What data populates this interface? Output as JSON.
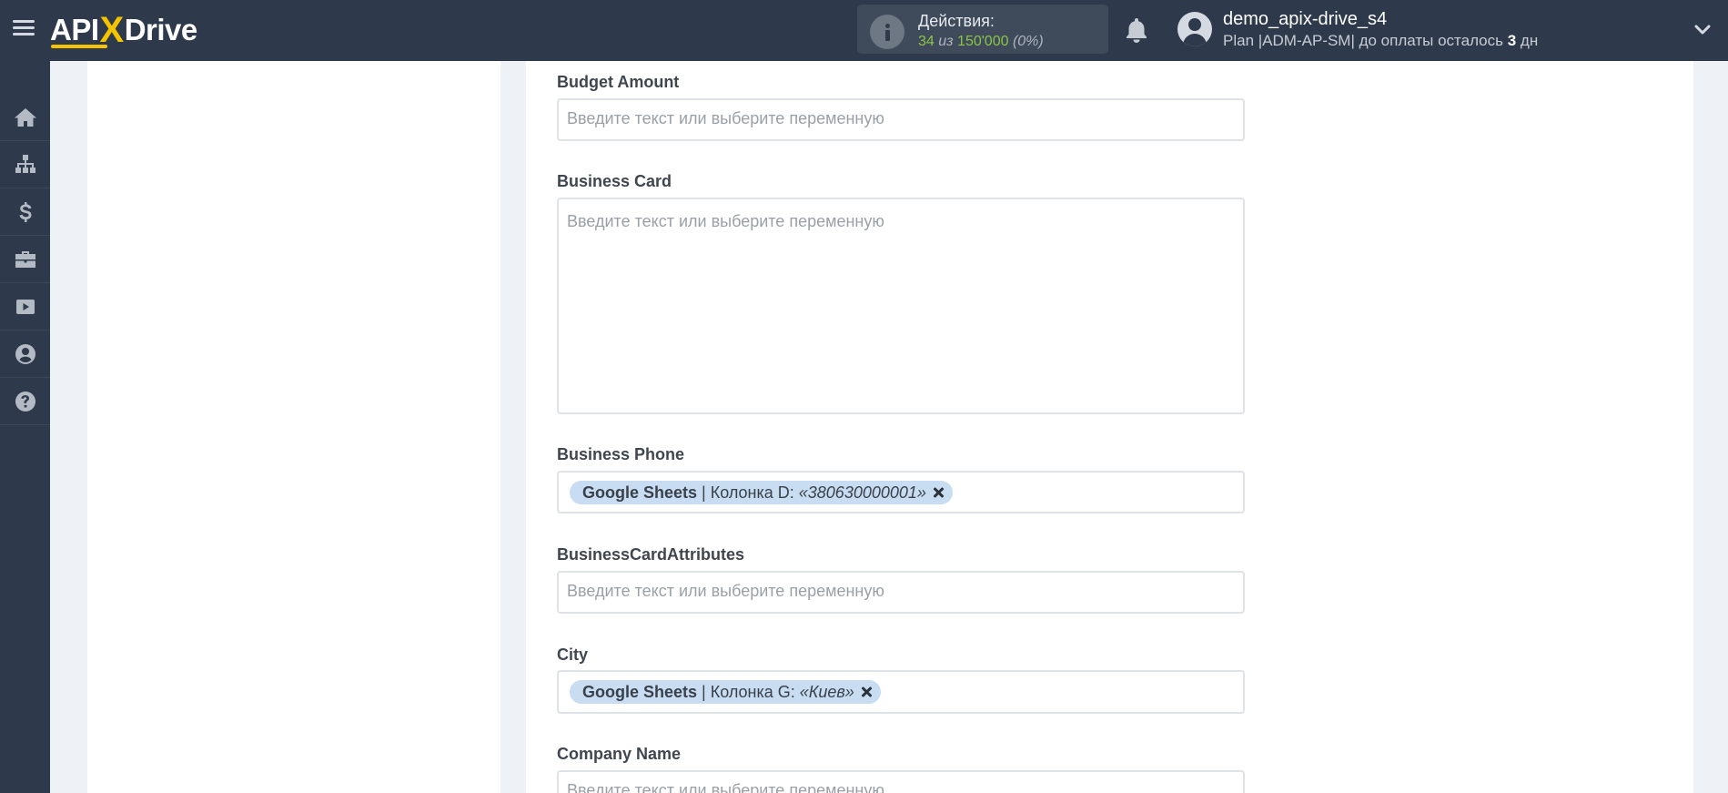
{
  "brand": {
    "logo_text_left": "API",
    "logo_text_x": "X",
    "logo_text_right": "Drive"
  },
  "header": {
    "actions_title": "Действия:",
    "actions_used": "34",
    "actions_of": "из",
    "actions_total": "150'000",
    "actions_pct": "(0%)",
    "user_name": "demo_apix-drive_s4",
    "plan_prefix": "Plan |ADM-AP-SM| до оплаты осталось ",
    "plan_days": "3",
    "plan_suffix": " дн"
  },
  "sidebar": {
    "items": [
      {
        "icon": "home-icon"
      },
      {
        "icon": "sitemap-icon"
      },
      {
        "icon": "dollar-icon"
      },
      {
        "icon": "briefcase-icon"
      },
      {
        "icon": "youtube-icon"
      },
      {
        "icon": "user-icon"
      },
      {
        "icon": "help-icon"
      }
    ]
  },
  "form": {
    "placeholder": "Введите текст или выберите переменную",
    "fields": {
      "budget_amount": {
        "label": "Budget Amount"
      },
      "business_card": {
        "label": "Business Card"
      },
      "business_phone": {
        "label": "Business Phone",
        "tag": {
          "source": "Google Sheets",
          "separator": "|",
          "column": "Колонка D:",
          "value": "«380630000001»"
        }
      },
      "business_card_attributes": {
        "label": "BusinessCardAttributes"
      },
      "city": {
        "label": "City",
        "tag": {
          "source": "Google Sheets",
          "separator": "|",
          "column": "Колонка G:",
          "value": "«Киев»"
        }
      },
      "company_name": {
        "label": "Company Name"
      }
    }
  },
  "colors": {
    "header_bg": "#2e3a4b",
    "accent_yellow": "#f5c400",
    "tag_bg": "#c8ddf2",
    "green": "#8bc34a"
  }
}
